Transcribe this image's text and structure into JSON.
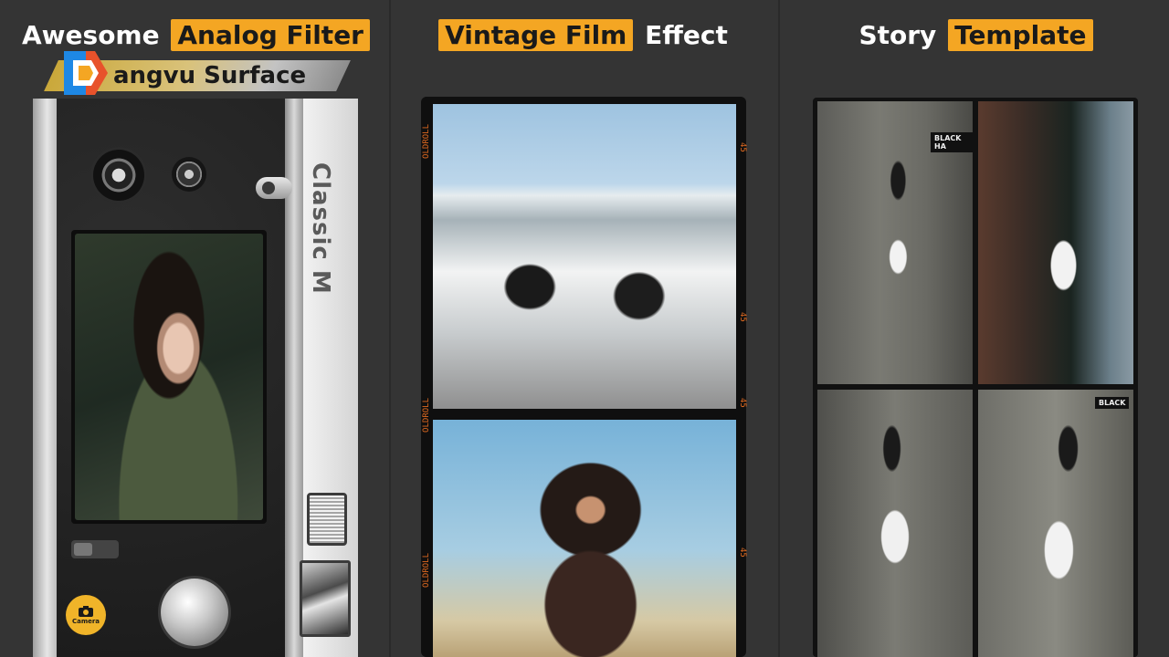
{
  "panels": [
    {
      "title_plain": "Awesome",
      "title_highlight": "Analog Filter"
    },
    {
      "title_highlight": "Vintage Film",
      "title_plain": "Effect"
    },
    {
      "title_plain": "Story",
      "title_highlight": "Template"
    }
  ],
  "watermark": {
    "text": "angvu Surface"
  },
  "camera": {
    "model_label": "Classic M",
    "camera_button_label": "Camera"
  },
  "film": {
    "edge_code": "OLDROLL",
    "frame_marker": "45"
  },
  "collage": {
    "tag_1": "BLACK HA",
    "tag_2": "BLACK"
  },
  "colors": {
    "highlight": "#f4a623",
    "background": "#343434",
    "film_code": "#e06a20"
  }
}
